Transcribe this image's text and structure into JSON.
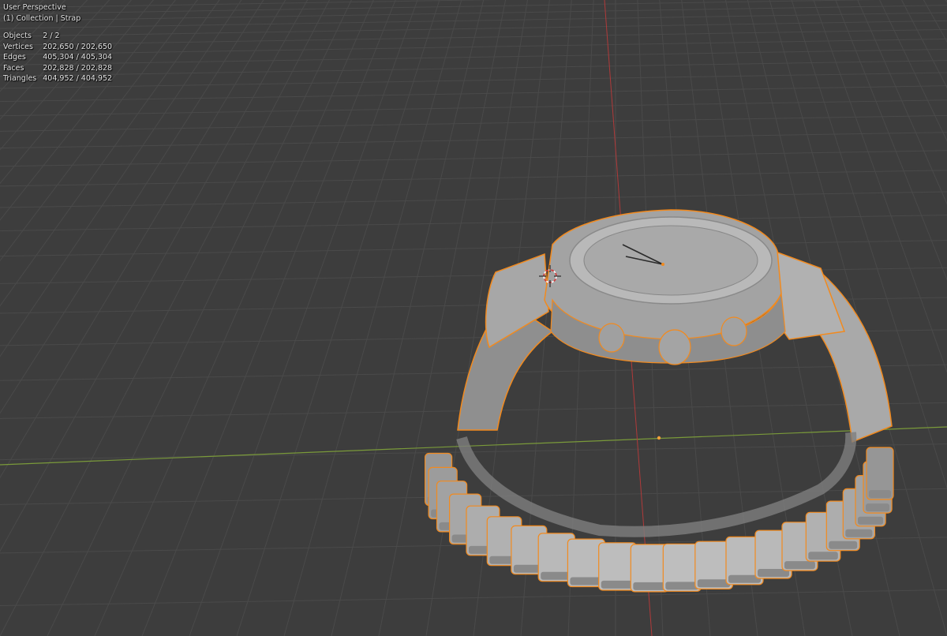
{
  "viewport": {
    "view_name": "User Perspective",
    "collection_line": "(1) Collection | Strap",
    "stats": [
      {
        "label": "Objects",
        "value": "2 / 2"
      },
      {
        "label": "Vertices",
        "value": "202,650 / 202,650"
      },
      {
        "label": "Edges",
        "value": "405,304 / 405,304"
      },
      {
        "label": "Faces",
        "value": "202,828 / 202,828"
      },
      {
        "label": "Triangles",
        "value": "404,952 / 404,952"
      }
    ]
  },
  "colors": {
    "background": "#3d3d3d",
    "grid_line": "#4a4a4a",
    "x_axis": "#7a9a3a",
    "y_axis": "#b03a3a",
    "selection_outline": "#f28a1e",
    "model_light": "#bdbdbd",
    "model_mid": "#9b9b9b",
    "model_dark": "#6f6f6f"
  },
  "scene_objects": {
    "selected": "Strap",
    "icons": [
      "3d-cursor-icon",
      "origin-point-icon"
    ]
  }
}
